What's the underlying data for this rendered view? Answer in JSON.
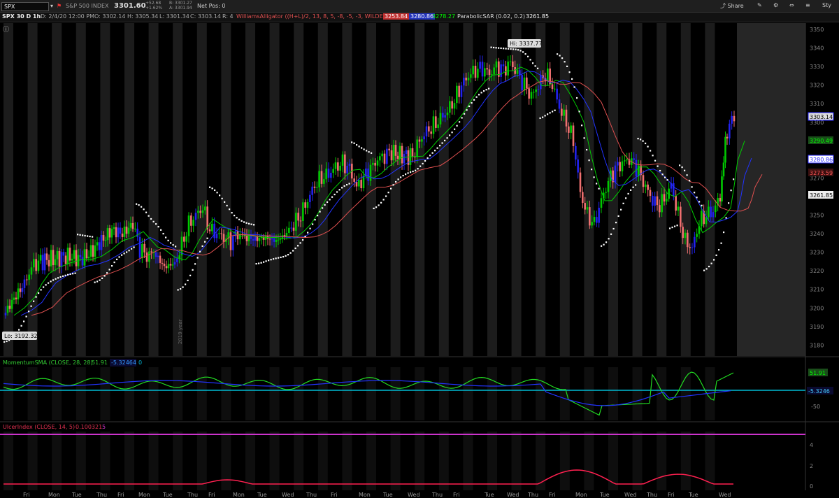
{
  "toolbar": {
    "symbol": "SPX",
    "name": "S&P 500 INDEX",
    "last": "3301.60",
    "change": "+52.68",
    "change_pct": "+1.62%",
    "bid": "B: 3301.27",
    "ask": "A: 3301.94",
    "netpos": "Net Pos: 0",
    "share": "Share",
    "style": "Sty"
  },
  "info": {
    "title": "SPX 30 D 1h",
    "date": "D: 2/4/20 12:00 PM",
    "open": "O: 3302.14",
    "high": "H: 3305.34",
    "low": "L: 3301.34",
    "close": "C: 3303.14",
    "range": "R: 4",
    "alligator_label": "WilliamsAlligator ((H+L)/2, 13, 8, 5, -8, -5, -3, WILDERS)",
    "alligator_v1": "3253.84",
    "alligator_v2": "3280.86",
    "alligator_v3": "3278.27",
    "sar_label": "ParabolicSAR (0.02, 0.2)",
    "sar_v": "3261.85"
  },
  "price_axis": {
    "ticks": [
      "3350",
      "3340",
      "3330",
      "3320",
      "3310",
      "3300",
      "3290",
      "3280",
      "3270",
      "3260",
      "3250",
      "3240",
      "3230",
      "3220",
      "3210",
      "3200",
      "3190",
      "3180"
    ],
    "badges": {
      "last": "3303.14",
      "green": "3290.49",
      "blue": "3280.86",
      "red": "3273.59",
      "sar": "3261.85"
    },
    "hi": "Hi: 3337.77",
    "lo": "Lo: 3192.32"
  },
  "momentum": {
    "label": "MomentumSMA (CLOSE, 28, 28)",
    "v1": "51.91",
    "v2": "-5.32464",
    "v3": "0",
    "badge_green": "51.91",
    "badge_cyan": "-5.3246",
    "tick": "-50"
  },
  "ulcer": {
    "label": "UlcerIndex (CLOSE, 14, 5)",
    "v1": "0.100321",
    "v2": "5",
    "ticks": [
      "4",
      "2",
      "0"
    ]
  },
  "x_axis": {
    "days": [
      "Fri",
      "Mon",
      "Tue",
      "Thu",
      "Fri",
      "Mon",
      "Tue",
      "Thu",
      "Fri",
      "Mon",
      "Tue",
      "Wed",
      "Thu",
      "Fri",
      "Mon",
      "Tue",
      "Wed",
      "Thu",
      "Fri",
      "Tue",
      "Wed",
      "Thu",
      "Fri",
      "Mon",
      "Tue",
      "Wed",
      "Thu",
      "Fri",
      "Tue",
      "Wed"
    ]
  },
  "annotations": {
    "year": "2019 year"
  },
  "colors": {
    "up": "#00c800",
    "down": "#f07070",
    "blueBar": "#2222ee",
    "lipsGreen": "#00cc00",
    "teethRed": "#e05050",
    "jawBlue": "#2233ff",
    "cyan": "#00bcd4",
    "magenta": "#cc33cc"
  }
}
